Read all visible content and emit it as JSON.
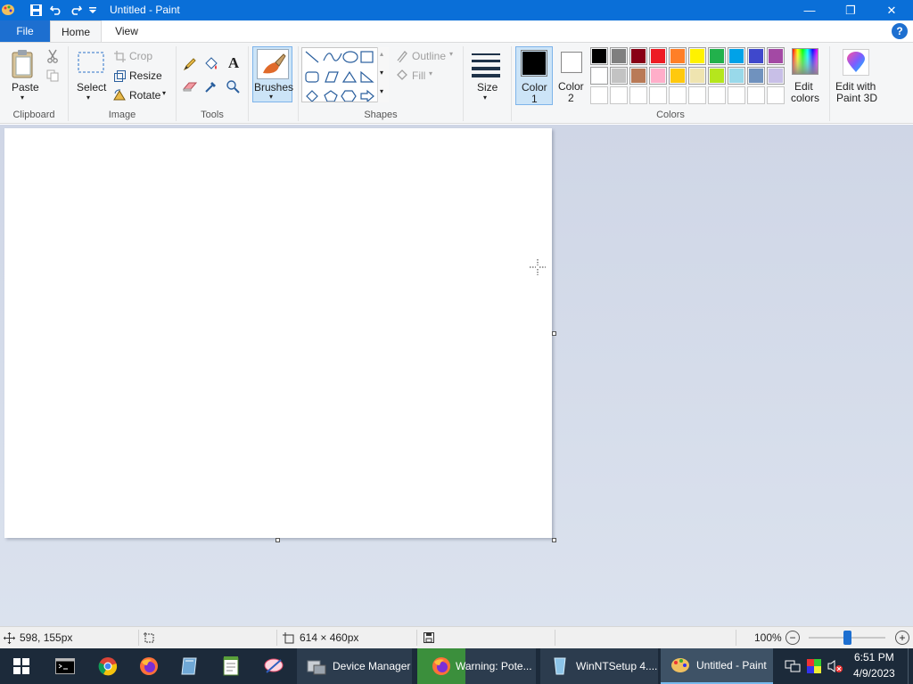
{
  "titlebar": {
    "title": "Untitled - Paint",
    "minimize": "—",
    "maximize": "❐",
    "close": "✕"
  },
  "tabs": {
    "file": "File",
    "home": "Home",
    "view": "View",
    "help": "?"
  },
  "clipboard": {
    "paste": "Paste",
    "group": "Clipboard"
  },
  "image": {
    "select": "Select",
    "crop": "Crop",
    "resize": "Resize",
    "rotate": "Rotate",
    "group": "Image"
  },
  "tools": {
    "group": "Tools"
  },
  "brushes": {
    "label": "Brushes"
  },
  "shapes": {
    "outline": "Outline",
    "fill": "Fill",
    "group": "Shapes"
  },
  "size": {
    "label": "Size"
  },
  "colors": {
    "color1": "Color",
    "color1_num": "1",
    "color2": "Color",
    "color2_num": "2",
    "edit_colors_1": "Edit",
    "edit_colors_2": "colors",
    "paint3d_1": "Edit with",
    "paint3d_2": "Paint 3D",
    "group": "Colors",
    "color1_value": "#000000",
    "color2_value": "#ffffff",
    "palette_row1": [
      "#000000",
      "#7f7f7f",
      "#880015",
      "#ed1c24",
      "#ff7f27",
      "#fff200",
      "#22b14c",
      "#00a2e8",
      "#3f48cc",
      "#a349a4"
    ],
    "palette_row2": [
      "#ffffff",
      "#c3c3c3",
      "#b97a57",
      "#ffaec9",
      "#ffc90e",
      "#efe4b0",
      "#b5e61d",
      "#99d9ea",
      "#7092be",
      "#c8bfe7"
    ]
  },
  "status": {
    "cursor_pos": "598, 155px",
    "canvas_size": "614 × 460px",
    "zoom": "100%",
    "zoom_level": 0.5
  },
  "taskbar": {
    "device_manager": "Device Manager",
    "warning": "Warning: Pote...",
    "winntsetup": "WinNTSetup 4....",
    "paint": "Untitled - Paint",
    "time": "6:51 PM",
    "date": "4/9/2023"
  }
}
